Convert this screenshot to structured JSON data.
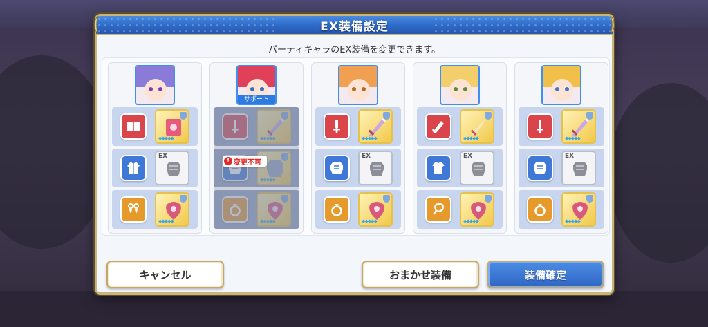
{
  "dialog": {
    "title": "EX装備設定",
    "subtitle": "パーティキャラのEX装備を変更できます。"
  },
  "characters": [
    {
      "portrait_colors": {
        "hair": "#8a7bd8",
        "eyes": "#7a3fb0"
      },
      "support": null,
      "locked": false,
      "slots": [
        {
          "category": "book-icon",
          "color": "red",
          "equip": "book-equip-icon",
          "equip_state": "equipped"
        },
        {
          "category": "robe-icon",
          "color": "blue",
          "equip": "armor-empty-icon",
          "equip_state": "ex-empty",
          "ex_label": "EX"
        },
        {
          "category": "earring-icon",
          "color": "orange",
          "equip": "accessory-equip-icon",
          "equip_state": "equipped"
        }
      ]
    },
    {
      "portrait_colors": {
        "hair": "#e0405a",
        "eyes": "#2f6fd0"
      },
      "support": "サポート",
      "locked": true,
      "locked_label": "変更不可",
      "slots": [
        {
          "category": "sword-icon",
          "color": "red",
          "equip": "sword-equip-icon",
          "equip_state": "equipped"
        },
        {
          "category": "armor-icon",
          "color": "blue",
          "equip": "armor-equip-icon",
          "equip_state": "equipped"
        },
        {
          "category": "ring-icon",
          "color": "orange",
          "equip": "accessory-equip-icon",
          "equip_state": "equipped"
        }
      ]
    },
    {
      "portrait_colors": {
        "hair": "#f0a050",
        "eyes": "#b06a2a"
      },
      "support": null,
      "locked": false,
      "slots": [
        {
          "category": "sword-icon",
          "color": "red",
          "equip": "sword-equip-icon",
          "equip_state": "equipped"
        },
        {
          "category": "armor-icon",
          "color": "blue",
          "equip": "armor-empty-icon",
          "equip_state": "ex-empty",
          "ex_label": "EX"
        },
        {
          "category": "ring-icon",
          "color": "orange",
          "equip": "accessory-equip-icon",
          "equip_state": "equipped"
        }
      ]
    },
    {
      "portrait_colors": {
        "hair": "#f2cf6a",
        "eyes": "#5a8a3a"
      },
      "support": null,
      "locked": false,
      "slots": [
        {
          "category": "blade-icon",
          "color": "red",
          "equip": "dagger-equip-icon",
          "equip_state": "equipped"
        },
        {
          "category": "shirt-icon",
          "color": "blue",
          "equip": "armor-empty-icon",
          "equip_state": "ex-empty",
          "ex_label": "EX"
        },
        {
          "category": "whip-icon",
          "color": "orange",
          "equip": "accessory-equip-icon",
          "equip_state": "equipped"
        }
      ]
    },
    {
      "portrait_colors": {
        "hair": "#f0c04a",
        "eyes": "#3a7ad0"
      },
      "support": null,
      "locked": false,
      "slots": [
        {
          "category": "sword-icon",
          "color": "red",
          "equip": "sword-equip-icon",
          "equip_state": "equipped"
        },
        {
          "category": "armor-icon",
          "color": "blue",
          "equip": "armor-empty-icon",
          "equip_state": "ex-empty",
          "ex_label": "EX"
        },
        {
          "category": "ring-icon",
          "color": "orange",
          "equip": "accessory-equip-icon",
          "equip_state": "equipped"
        }
      ]
    }
  ],
  "buttons": {
    "cancel": "キャンセル",
    "auto": "おまかせ装備",
    "confirm": "装備確定"
  },
  "colors": {
    "accent_blue": "#2f6cc9",
    "gold_border": "#c9b57a",
    "locked_red": "#e02b2b"
  }
}
